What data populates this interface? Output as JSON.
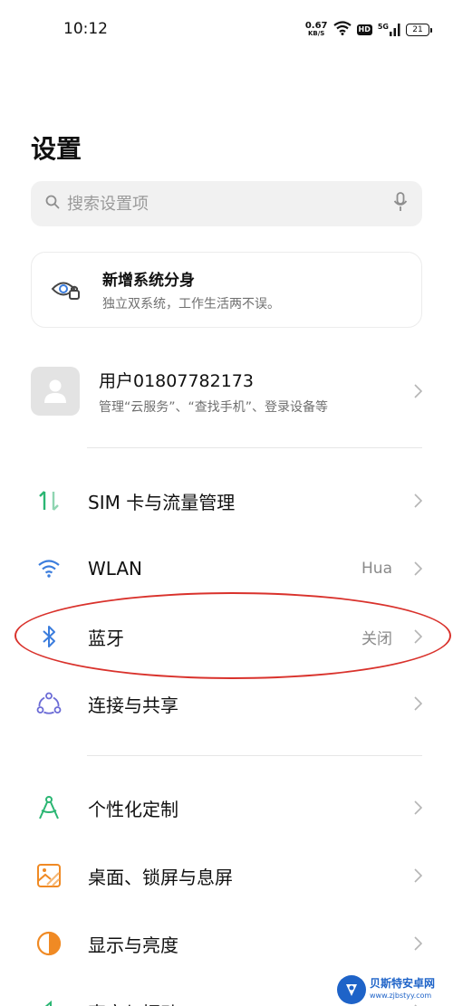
{
  "status_bar": {
    "time": "10:12",
    "net_speed_value": "0.67",
    "net_speed_unit": "KB/S",
    "hd_label": "HD",
    "network_label": "5G",
    "battery_level": "21"
  },
  "header": {
    "title": "设置"
  },
  "search": {
    "placeholder": "搜索设置项"
  },
  "promo": {
    "title": "新增系统分身",
    "subtitle": "独立双系统，工作生活两不误。",
    "icon": "dual-system-eye-icon"
  },
  "account": {
    "name": "用户01807782173",
    "subtitle": "管理“云服务”、“查找手机”、登录设备等",
    "icon": "person-icon"
  },
  "settings_items": [
    {
      "label": "SIM 卡与流量管理",
      "value": "",
      "icon": "sim-data-arrows-icon",
      "color": "#2bb673"
    },
    {
      "label": "WLAN",
      "value": "Hua",
      "icon": "wifi-icon",
      "color": "#3b7ddd"
    },
    {
      "label": "蓝牙",
      "value": "关闭",
      "icon": "bluetooth-icon",
      "color": "#3b7ddd"
    },
    {
      "label": "连接与共享",
      "value": "",
      "icon": "share-connect-icon",
      "color": "#6b6bd6"
    },
    {
      "label": "个性化定制",
      "value": "",
      "icon": "compass-icon",
      "color": "#2bb673"
    },
    {
      "label": "桌面、锁屏与息屏",
      "value": "",
      "icon": "wallpaper-icon",
      "color": "#f08a24"
    },
    {
      "label": "显示与亮度",
      "value": "",
      "icon": "brightness-icon",
      "color": "#f08a24"
    },
    {
      "label": "声音与振动",
      "value": "",
      "icon": "sound-icon",
      "color": "#2bb673"
    }
  ],
  "watermark": {
    "name": "贝斯特安卓网",
    "url": "www.zjbstyy.com"
  },
  "colors": {
    "annotation": "#d9322c",
    "accent_blue": "#3b7ddd",
    "accent_green": "#2bb673",
    "accent_orange": "#f08a24"
  }
}
